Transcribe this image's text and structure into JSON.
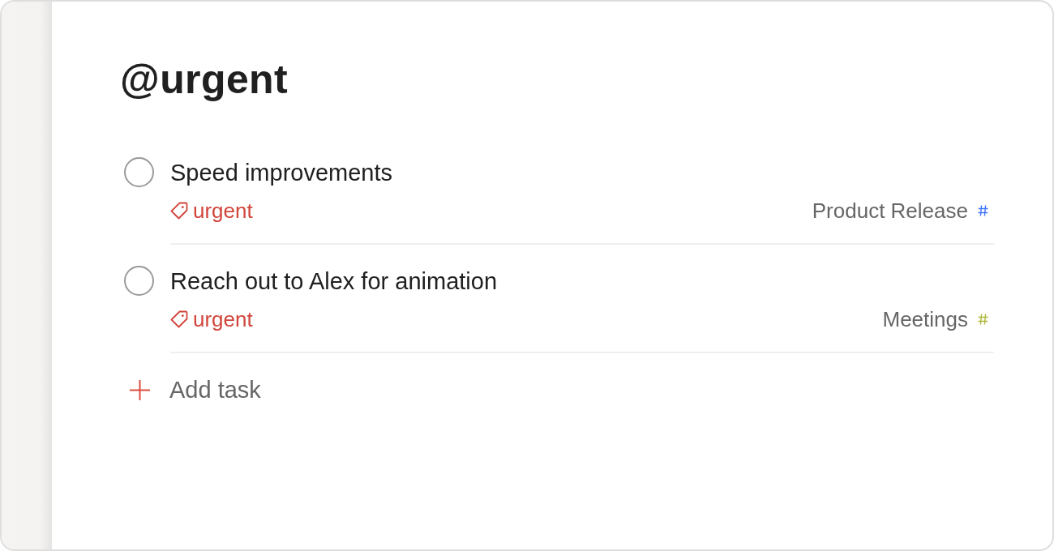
{
  "page": {
    "title": "@urgent"
  },
  "tasks": [
    {
      "title": "Speed improvements",
      "checked": false,
      "label": "urgent",
      "project": {
        "name": "Product Release",
        "color": "#4073ff"
      }
    },
    {
      "title": "Reach out to Alex for animation",
      "checked": false,
      "label": "urgent",
      "project": {
        "name": "Meetings",
        "color": "#afb83b"
      }
    }
  ],
  "add_task": {
    "label": "Add task"
  }
}
